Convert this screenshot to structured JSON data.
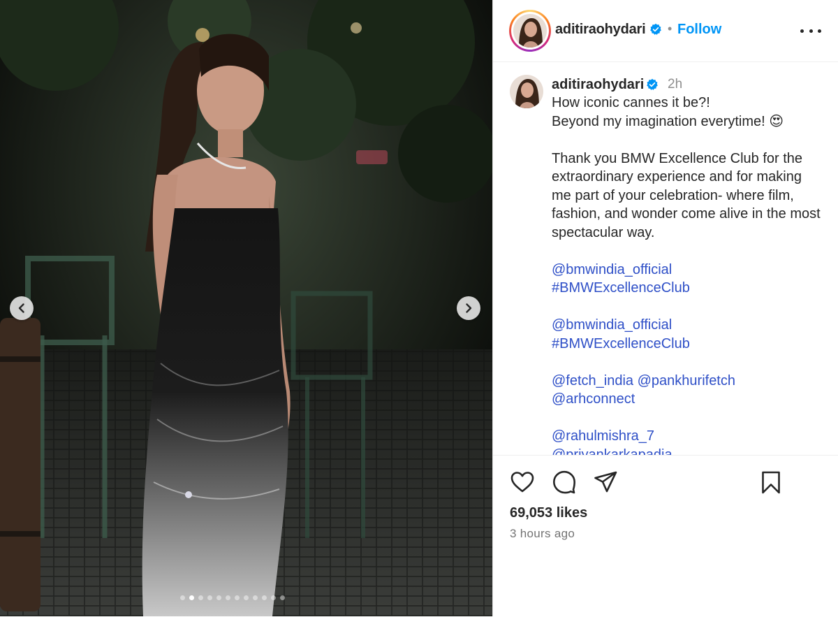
{
  "post": {
    "image": {
      "carousel_count": 12,
      "active_index": 1,
      "prev_icon": "chevron-left-icon",
      "next_icon": "chevron-right-icon"
    },
    "header": {
      "username": "aditiraohydari",
      "verified": true,
      "separator": "•",
      "follow_label": "Follow",
      "more_icon": "more-horizontal-icon"
    },
    "caption": {
      "username": "aditiraohydari",
      "time": "2h",
      "line1": "How iconic cannes it be?!",
      "line2": "Beyond my imagination everytime! 😍",
      "paragraph": "Thank you BMW Excellence Club for the extraordinary experience and for making me part of your celebration- where film, fashion, and wonder come alive in the most spectacular way.",
      "mention_bmw_1": "@bmwindia_official",
      "hashtag_1": "#BMWExcellenceClub",
      "mention_bmw_2": "@bmwindia_official",
      "hashtag_2": "#BMWExcellenceClub",
      "mention_fetch": "@fetch_india",
      "mention_pankhuri": "@pankhurifetch",
      "mention_arh": "@arhconnect",
      "mention_rahul": "@rahulmishra_7",
      "mention_partial": "@priyankarkapadia"
    },
    "actions": {
      "like_icon": "heart-icon",
      "comment_icon": "comment-icon",
      "share_icon": "share-icon",
      "save_icon": "bookmark-icon"
    },
    "likes_text": "69,053 likes",
    "posted_ago": "3 hours ago",
    "colors": {
      "link": "#2e4fc7",
      "follow": "#0095f6",
      "verified": "#0095f6",
      "muted": "#737373"
    }
  }
}
